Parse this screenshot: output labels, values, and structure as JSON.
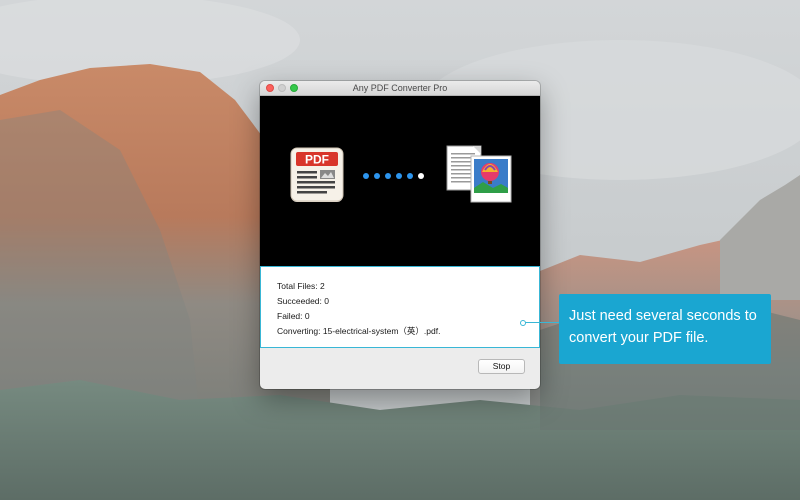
{
  "window": {
    "title": "Any PDF Converter Pro"
  },
  "conversion": {
    "source_icon": "pdf-document-icon",
    "source_badge": "PDF",
    "target_icon": "image-file-icon",
    "progress_dots_total": 6,
    "progress_dots_active": 5,
    "dot_active_color": "#2d95ee",
    "dot_inactive_color": "#ffffff"
  },
  "status": {
    "total_files": "Total Files: 2",
    "succeeded": "Succeeded: 0",
    "failed": "Failed: 0",
    "converting": "Converting: 15-electrical-system（英）.pdf."
  },
  "buttons": {
    "stop_label": "Stop"
  },
  "callout": {
    "line1": "Just need several seconds to",
    "line2": "convert your PDF file."
  },
  "colors": {
    "accent": "#39b7d6",
    "callout_bg": "#1aa6d1",
    "pdf_red": "#d8352a"
  }
}
